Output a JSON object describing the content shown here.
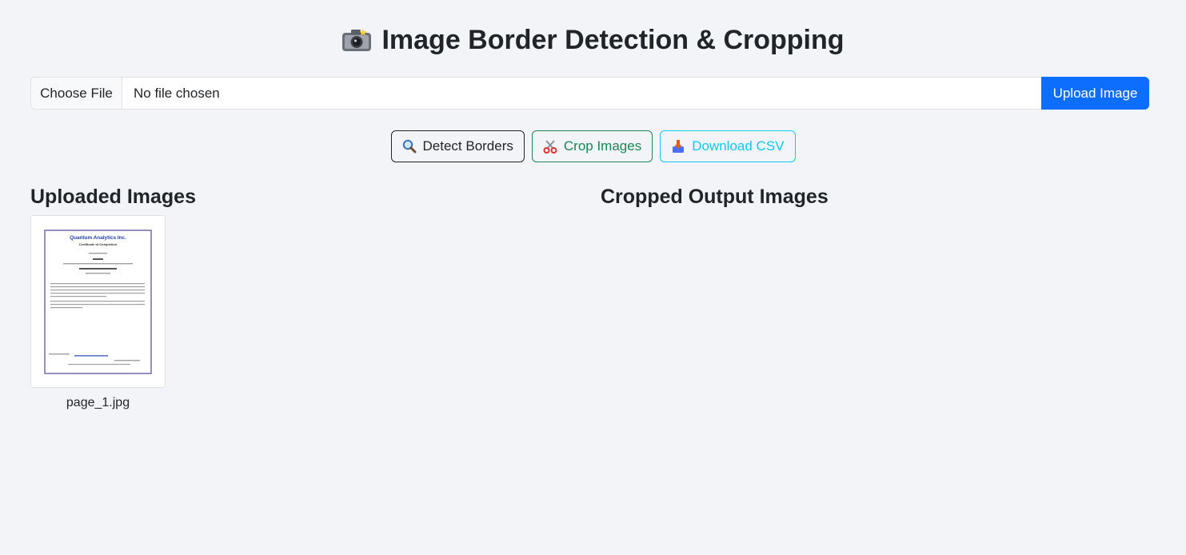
{
  "header": {
    "title": "Image Border Detection & Cropping",
    "icon": "camera-icon"
  },
  "upload": {
    "choose_label": "Choose File",
    "file_status": "No file chosen",
    "upload_label": "Upload Image"
  },
  "actions": {
    "detect_label": "Detect Borders",
    "detect_icon": "magnifier-icon",
    "crop_label": "Crop Images",
    "crop_icon": "scissors-icon",
    "download_label": "Download CSV",
    "download_icon": "download-icon"
  },
  "sections": {
    "uploaded_title": "Uploaded Images",
    "cropped_title": "Cropped Output Images"
  },
  "uploaded_images": [
    {
      "filename": "page_1.jpg",
      "preview": {
        "company": "Quantum Analytics Inc.",
        "heading": "Certificate of Completion"
      }
    }
  ],
  "colors": {
    "primary": "#0d6efd",
    "success": "#198754",
    "info": "#0dcaf0",
    "dark": "#212529",
    "background": "#f3f4f8"
  }
}
